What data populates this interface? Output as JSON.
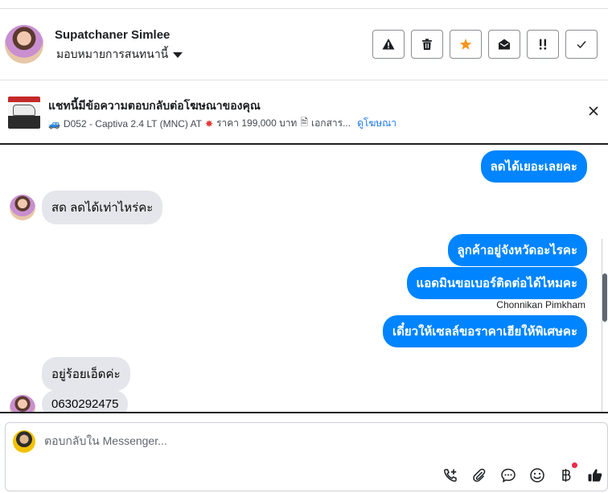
{
  "header": {
    "contact_name": "Supatchaner Simlee",
    "assign_label": "มอบหมายการสนทนานี้",
    "actions": [
      {
        "name": "report-button",
        "icon": "warning-icon"
      },
      {
        "name": "delete-button",
        "icon": "trash-icon"
      },
      {
        "name": "star-button",
        "icon": "star-icon",
        "color": "#f7931e"
      },
      {
        "name": "mark-unread-button",
        "icon": "envelope-open-icon"
      },
      {
        "name": "important-button",
        "icon": "exclamation-icon"
      },
      {
        "name": "done-button",
        "icon": "check-icon"
      }
    ]
  },
  "ad": {
    "title": "แชทนี้มีข้อความตอบกลับต่อโฆษณาของคุณ",
    "details": "D052 - Captiva 2.4 LT (MNC) AT",
    "price": "ราคา 199,000 บาท",
    "docs": "เอกสาร...",
    "link": "ดูโฆษณา"
  },
  "messages": [
    {
      "dir": "out",
      "text": "ลดได้เยอะเลยคะ"
    },
    {
      "dir": "in",
      "text": "สด ลดได้เท่าไหร่คะ"
    },
    {
      "dir": "out",
      "text": "ลูกค้าอยู่จังหวัดอะไรคะ"
    },
    {
      "dir": "out",
      "text": "แอดมินขอเบอร์ติดต่อได้ไหมคะ"
    },
    {
      "dir": "out",
      "text": "เดี๋ยวให้เซลล์ขอราคาเฮียให้พิเศษคะ"
    },
    {
      "dir": "in",
      "text": "อยู่ร้อยเอ็ดค่ะ"
    },
    {
      "dir": "in",
      "text": "0630292475"
    }
  ],
  "sender_name": "Chonnikan Pimkham",
  "composer": {
    "placeholder": "ตอบกลับใน Messenger...",
    "tools": [
      "call-add-icon",
      "paperclip-icon",
      "chat-bubble-icon",
      "emoji-icon",
      "baht-icon",
      "thumbs-up-icon"
    ]
  },
  "colors": {
    "accent": "#0084ff",
    "incoming_bubble": "#e4e6eb",
    "star": "#f7931e",
    "notification": "#f02849"
  }
}
